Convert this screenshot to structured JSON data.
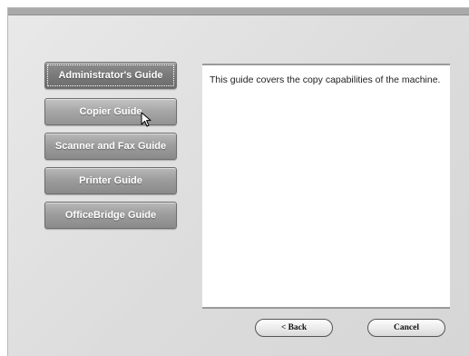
{
  "nav": {
    "items": [
      {
        "label": "Administrator's Guide",
        "state": "selected"
      },
      {
        "label": "Copier Guide",
        "state": "hover"
      },
      {
        "label": "Scanner and Fax Guide",
        "state": "normal"
      },
      {
        "label": "Printer Guide",
        "state": "normal"
      },
      {
        "label": "OfficeBridge Guide",
        "state": "normal"
      }
    ]
  },
  "description": {
    "text": "This guide covers the copy capabilities of the machine."
  },
  "footer": {
    "back_label": "< Back",
    "cancel_label": "Cancel"
  },
  "cursor": {
    "icon": "arrow-pointer-icon"
  },
  "colors": {
    "button_gray": "#9d9d9d",
    "panel_border": "#9a9a9a",
    "background": "#dcdcdc"
  }
}
